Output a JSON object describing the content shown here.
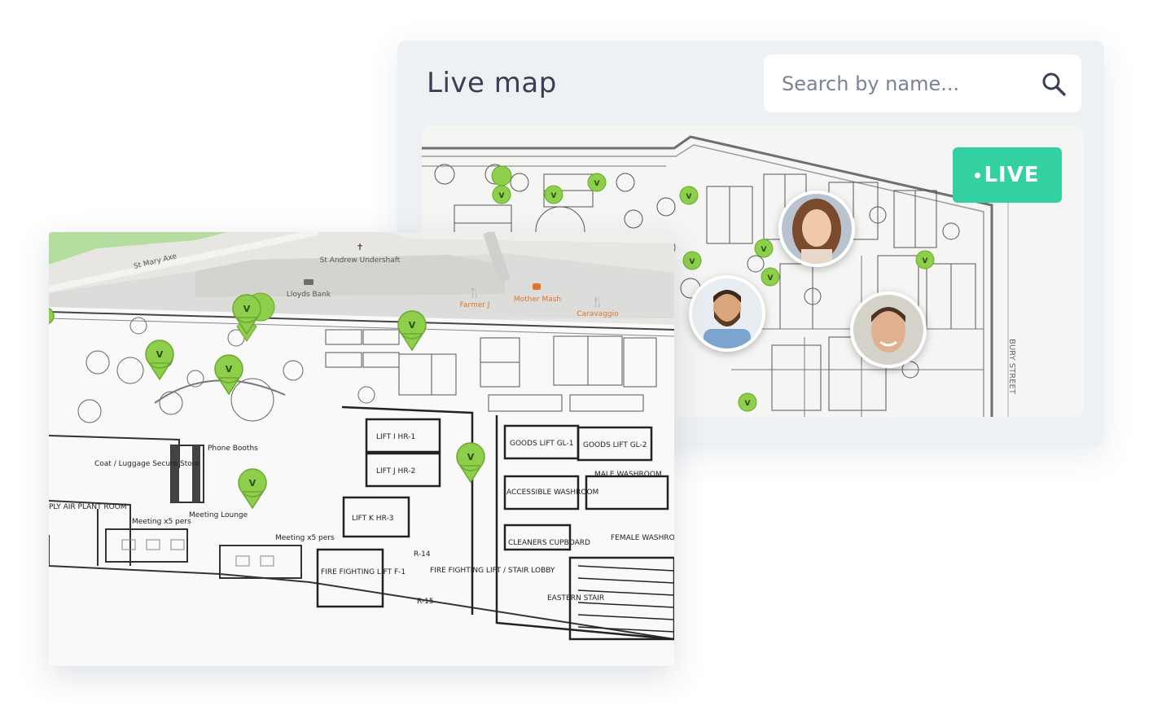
{
  "live_map": {
    "title": "Live map",
    "search": {
      "placeholder": "Search by name..."
    },
    "status_badge": "LIVE",
    "street_label": "BURY STREET",
    "icons": {
      "search": "magnifier-icon"
    }
  },
  "street_map": {
    "labels": {
      "st_mary_axe": "St Mary Axe",
      "st_andrew": "St Andrew Undershaft",
      "lloyds": "Lloyds Bank",
      "farmer_j": "Farmer J",
      "mother_mash": "Mother Mash",
      "caravaggio": "Caravaggio"
    }
  },
  "floor_plan": {
    "pin_label": "V",
    "rooms": {
      "phone_booths": "Phone Booths",
      "coat_storage": "Coat / Luggage Secure Store",
      "meeting_lounge": "Meeting Lounge",
      "meeting_5_left": "Meeting x5 pers",
      "meeting_5_right": "Meeting x5 pers",
      "lift_1": "LIFT I HR-1",
      "lift_2": "LIFT J HR-2",
      "lift_3": "LIFT K HR-3",
      "fire_lift": "FIRE FIGHTING LIFT F-1",
      "fire_lobby": "FIRE FIGHTING LIFT / STAIR LOBBY",
      "goods_lift_left": "GOODS LIFT GL-1",
      "goods_lift_right": "GOODS LIFT GL-2",
      "male_washroom": "MALE WASHROOM",
      "accessible_washroom": "ACCESSIBLE WASHROOM",
      "female_washroom": "FEMALE WASHROOM",
      "cleaners": "CLEANERS CUPBOARD",
      "eastern_stair": "EASTERN STAIR",
      "r14": "R-14",
      "r15": "R-15",
      "air_plant": "PLY AIR PLANT ROOM"
    }
  }
}
